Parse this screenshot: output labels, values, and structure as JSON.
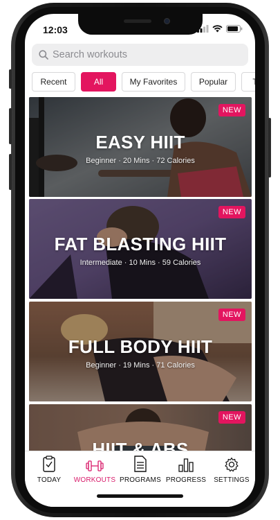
{
  "status": {
    "time": "12:03"
  },
  "search": {
    "placeholder": "Search workouts"
  },
  "filters": [
    {
      "label": "Recent"
    },
    {
      "label": "All"
    },
    {
      "label": "My Favorites"
    },
    {
      "label": "Popular"
    },
    {
      "label": "T"
    }
  ],
  "workouts": [
    {
      "badge": "NEW",
      "title": "EASY HIIT",
      "meta": "Beginner · 20 Mins · 72 Calories"
    },
    {
      "badge": "NEW",
      "title": "FAT BLASTING HIIT",
      "meta": "Intermediate · 10 Mins · 59 Calories"
    },
    {
      "badge": "NEW",
      "title": "FULL BODY HIIT",
      "meta": "Beginner · 19 Mins · 71 Calories"
    },
    {
      "badge": "NEW",
      "title": "HIIT & ABS",
      "meta": ""
    }
  ],
  "tabs": [
    {
      "label": "TODAY",
      "icon": "clipboard-check-icon"
    },
    {
      "label": "WORKOUTS",
      "icon": "dumbbell-icon"
    },
    {
      "label": "PROGRAMS",
      "icon": "document-icon"
    },
    {
      "label": "PROGRESS",
      "icon": "bar-chart-icon"
    },
    {
      "label": "SETTINGS",
      "icon": "gear-icon"
    }
  ],
  "colors": {
    "accent": "#e3155f",
    "active_tab": "#d81b6a"
  }
}
